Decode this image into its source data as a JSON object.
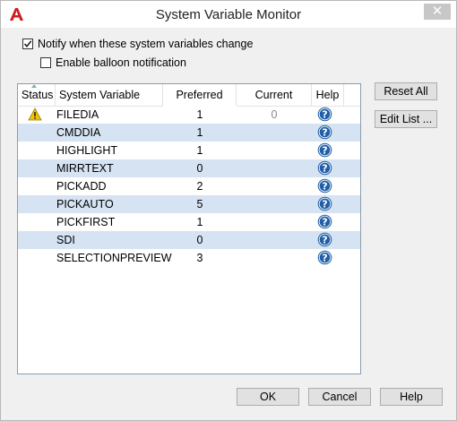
{
  "window": {
    "title": "System Variable Monitor",
    "close_glyph": "✕"
  },
  "options": {
    "notify_label": "Notify when these system variables change",
    "notify_checked": true,
    "balloon_label": "Enable balloon notification",
    "balloon_checked": false
  },
  "table": {
    "columns": {
      "status": "Status",
      "variable": "System Variable",
      "preferred": "Preferred",
      "current": "Current",
      "help": "Help"
    },
    "rows": [
      {
        "variable": "FILEDIA",
        "preferred": "1",
        "current": "0",
        "warning": true
      },
      {
        "variable": "CMDDIA",
        "preferred": "1",
        "current": ""
      },
      {
        "variable": "HIGHLIGHT",
        "preferred": "1",
        "current": ""
      },
      {
        "variable": "MIRRTEXT",
        "preferred": "0",
        "current": ""
      },
      {
        "variable": "PICKADD",
        "preferred": "2",
        "current": ""
      },
      {
        "variable": "PICKAUTO",
        "preferred": "5",
        "current": ""
      },
      {
        "variable": "PICKFIRST",
        "preferred": "1",
        "current": ""
      },
      {
        "variable": "SDI",
        "preferred": "0",
        "current": ""
      },
      {
        "variable": "SELECTIONPREVIEW",
        "preferred": "3",
        "current": ""
      }
    ]
  },
  "side_buttons": {
    "reset_all": "Reset All",
    "edit_list": "Edit List ..."
  },
  "footer": {
    "ok": "OK",
    "cancel": "Cancel",
    "help": "Help"
  },
  "colors": {
    "row_alt": "#d6e3f2",
    "help_icon": "#1f5fa8",
    "warning": "#f5c400",
    "app_icon": "#cc1f1f"
  },
  "icons": [
    "app-icon",
    "close-icon",
    "checkmark-icon",
    "warning-icon",
    "help-icon"
  ]
}
